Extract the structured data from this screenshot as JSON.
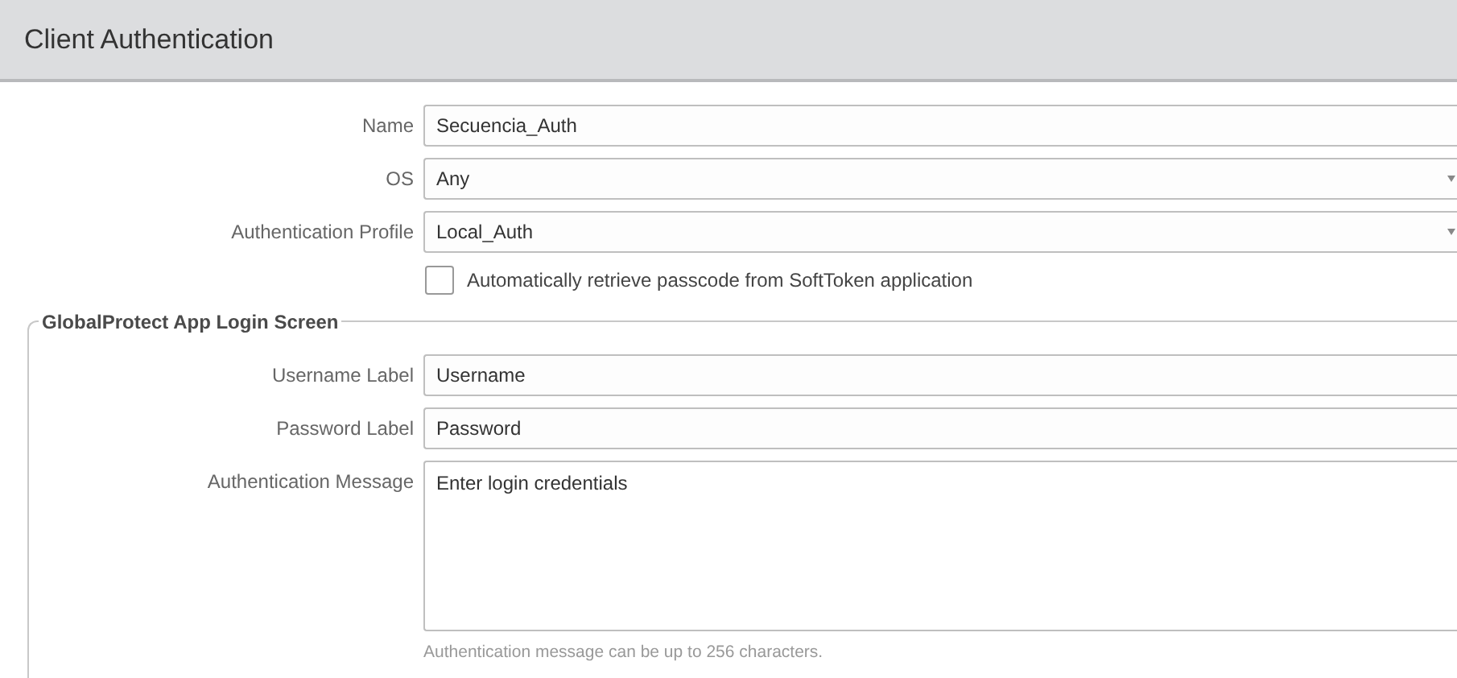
{
  "header": {
    "title": "Client Authentication"
  },
  "fields": [
    {
      "label": "Name",
      "value": "Secuencia_Auth",
      "kind": "text"
    },
    {
      "label": "OS",
      "value": "Any",
      "kind": "select"
    },
    {
      "label": "Authentication Profile",
      "value": "Local_Auth",
      "kind": "select"
    }
  ],
  "checkbox": {
    "label": "Automatically retrieve passcode from SoftToken application",
    "checked": false
  },
  "login_screen": {
    "legend": "GlobalProtect App Login Screen",
    "fields": [
      {
        "label": "Username Label",
        "value": "Username",
        "kind": "text"
      },
      {
        "label": "Password Label",
        "value": "Password",
        "kind": "text"
      },
      {
        "label": "Authentication Message",
        "value": "Enter login credentials",
        "kind": "textarea",
        "hint": "Authentication message can be up to 256 characters."
      }
    ]
  }
}
